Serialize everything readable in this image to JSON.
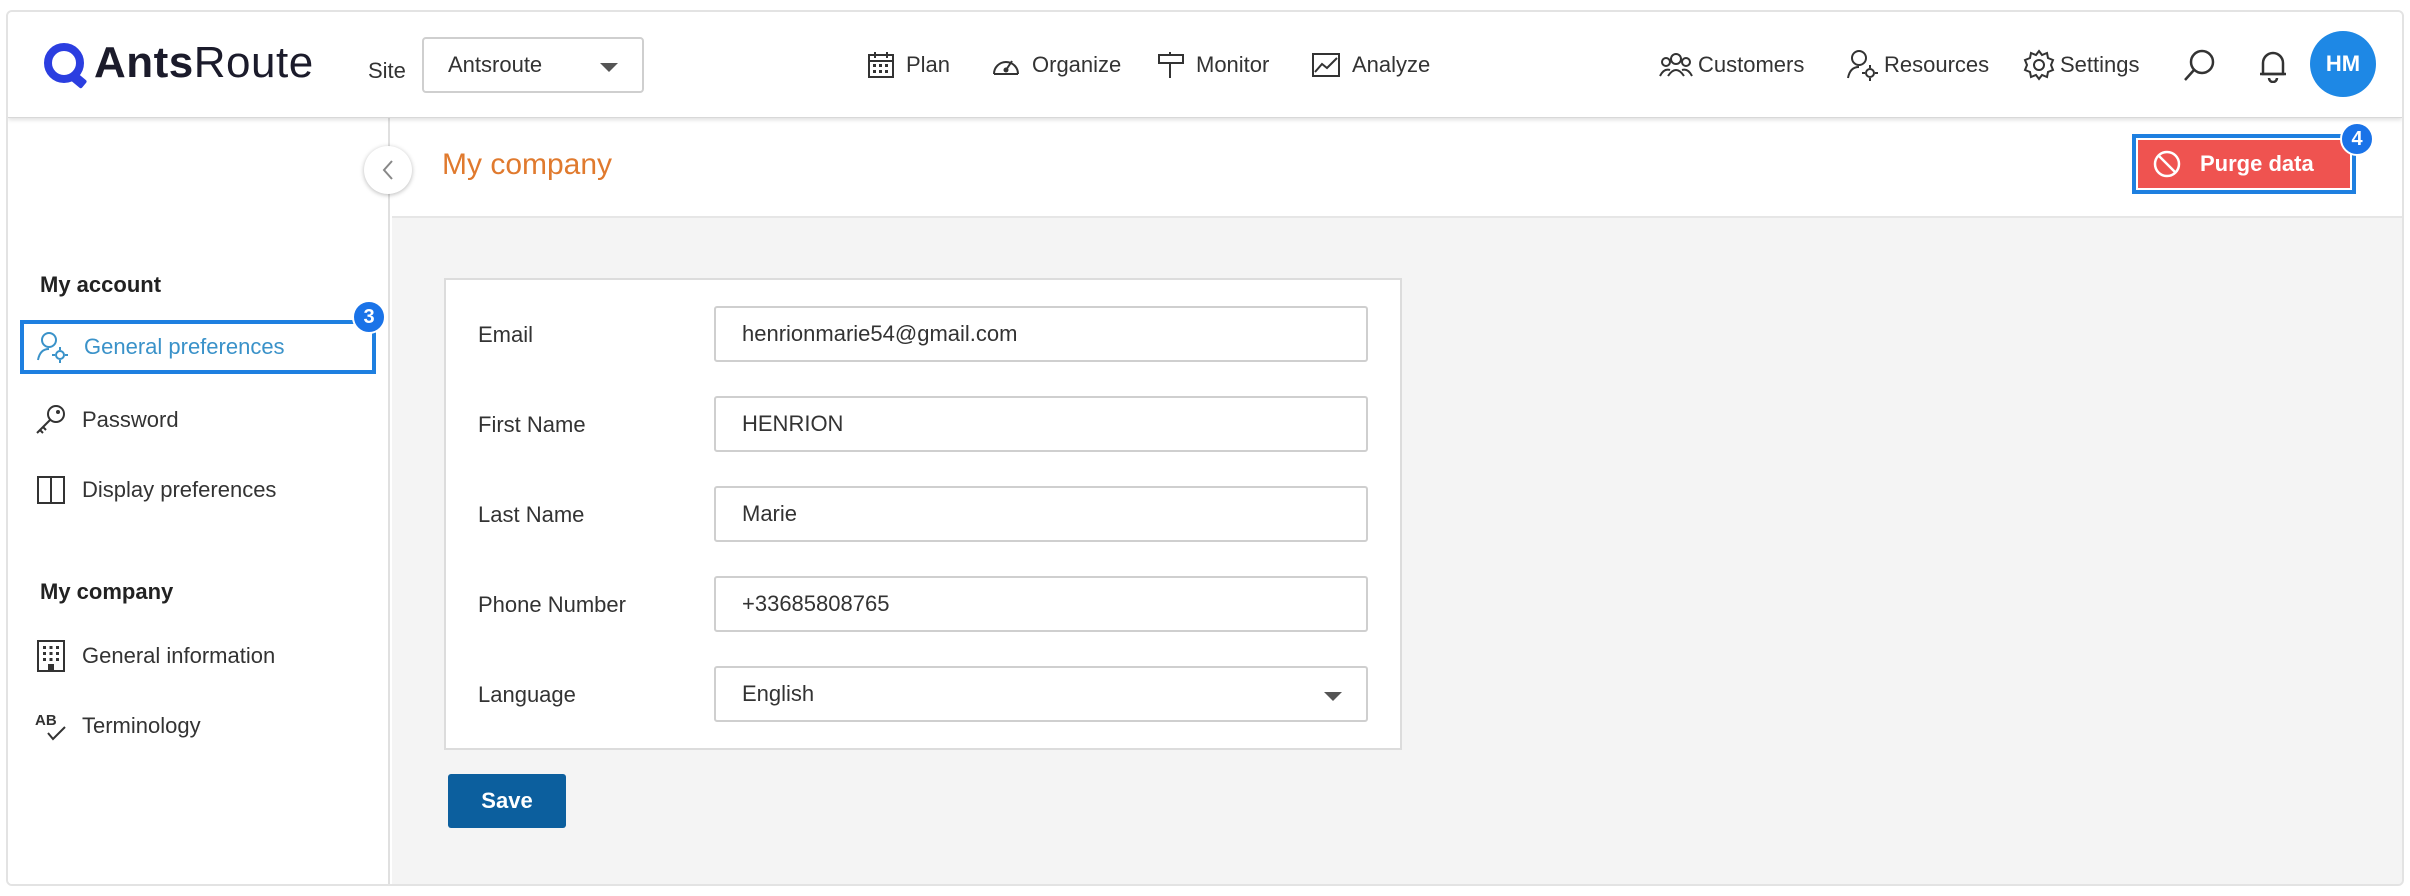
{
  "app": {
    "logo_text_bold": "Ants",
    "logo_text_light": "Route"
  },
  "topbar": {
    "site_label": "Site",
    "site_value": "Antsroute",
    "nav": [
      "Plan",
      "Organize",
      "Monitor",
      "Analyze"
    ],
    "right_nav": [
      "Customers",
      "Resources",
      "Settings"
    ],
    "avatar_initials": "HM"
  },
  "sidebar": {
    "my_account_title": "My account",
    "account_items": [
      "General preferences",
      "Password",
      "Display preferences"
    ],
    "my_company_title": "My company",
    "company_items": [
      "General information",
      "Terminology"
    ],
    "badge_general": "3"
  },
  "main": {
    "title": "My company",
    "purge_label": "Purge data",
    "purge_badge": "4",
    "form": {
      "email_label": "Email",
      "email_value": "henrionmarie54@gmail.com",
      "first_name_label": "First Name",
      "first_name_value": "HENRION",
      "last_name_label": "Last Name",
      "last_name_value": "Marie",
      "phone_label": "Phone Number",
      "phone_value": "+33685808765",
      "language_label": "Language",
      "language_value": "English"
    },
    "save_label": "Save"
  },
  "colors": {
    "accent_blue": "#1e88e5",
    "title_orange": "#e07a2e",
    "purge_red": "#ef5350",
    "save_blue": "#0c5f9e",
    "highlight_blue": "#1e7fe0"
  }
}
